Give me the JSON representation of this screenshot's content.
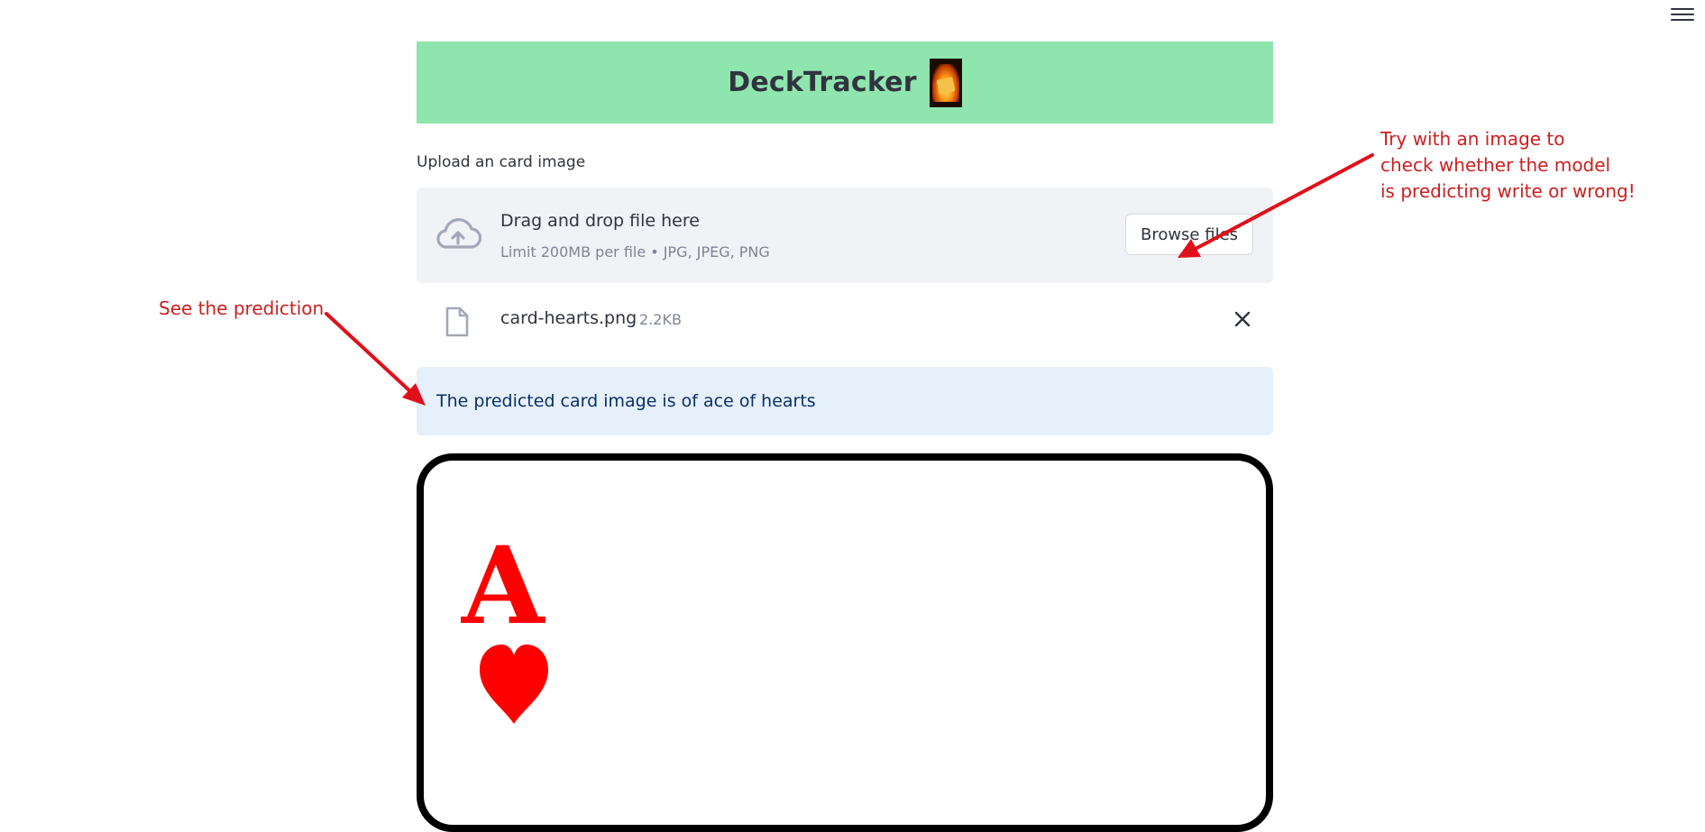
{
  "app": {
    "title": "DeckTracker",
    "menu_icon": "hamburger-menu-icon"
  },
  "uploader": {
    "label": "Upload an card image",
    "dropzone_title": "Drag and drop file here",
    "dropzone_limit": "Limit 200MB per file • JPG, JPEG, PNG",
    "browse_label": "Browse files",
    "upload_icon": "cloud-upload-icon"
  },
  "file": {
    "name": "card-hearts.png",
    "size": "2.2KB",
    "file_icon": "file-icon",
    "remove_icon": "close-icon"
  },
  "prediction": {
    "text": "The predicted card image is of ace of hearts"
  },
  "card": {
    "rank": "A",
    "suit": "hearts",
    "suit_color": "#ff0000"
  },
  "annotations": {
    "prediction_note": "See the prediction",
    "upload_note_lines": [
      "Try with an image to",
      "check whether the model",
      "is predicting write or wrong!"
    ],
    "arrow_color": "#e0101a"
  },
  "colors": {
    "header_bg": "#8fe5ae",
    "dropzone_bg": "#f0f2f6",
    "alert_bg": "#e6f0fb",
    "alert_text": "#0a3069",
    "annotation_text": "#cc1f1f"
  }
}
